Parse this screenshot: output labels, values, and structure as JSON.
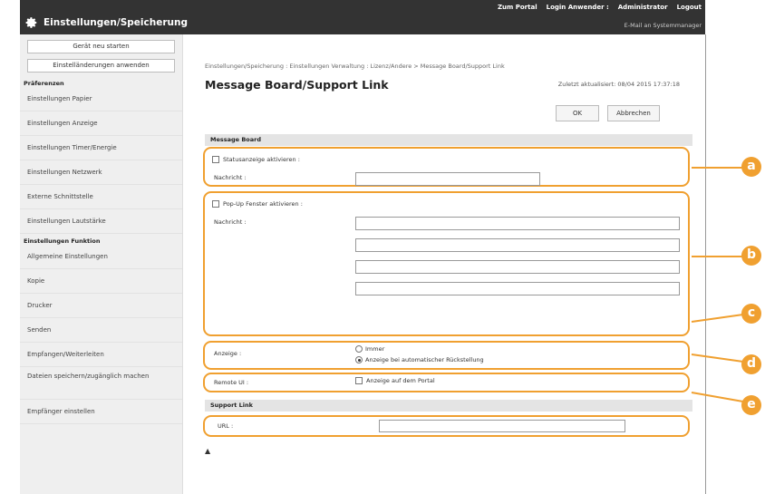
{
  "topbar": {
    "portal": "Zum Portal",
    "login_label": "Login Anwender :",
    "user": "Administrator",
    "logout": "Logout"
  },
  "header": {
    "title": "Einstellungen/Speicherung",
    "mail": "E-Mail an Systemmanager"
  },
  "sidebar": {
    "restart": "Gerät neu starten",
    "apply": "Einstelländerungen anwenden",
    "section1": "Präferenzen",
    "items1": [
      "Einstellungen Papier",
      "Einstellungen Anzeige",
      "Einstellungen Timer/Energie",
      "Einstellungen Netzwerk",
      "Externe Schnittstelle",
      "Einstellungen Lautstärke"
    ],
    "section2": "Einstellungen Funktion",
    "items2": [
      "Allgemeine Einstellungen",
      "Kopie",
      "Drucker",
      "Senden",
      "Empfangen/Weiterleiten",
      "Dateien speichern/zugänglich machen",
      "Empfänger einstellen"
    ]
  },
  "main": {
    "breadcrumb": "Einstellungen/Speicherung : Einstellungen Verwaltung : Lizenz/Andere > Message Board/Support Link",
    "title": "Message Board/Support Link",
    "updated": "Zuletzt aktualisiert: 08/04 2015 17:37:18",
    "ok": "OK",
    "cancel": "Abbrechen",
    "message_board": "Message Board",
    "status_enable": "Statusanzeige aktivieren :",
    "message_label": "Nachricht :",
    "popup_enable": "Pop-Up Fenster aktivieren :",
    "popup_message_label": "Nachricht :",
    "display_label": "Anzeige :",
    "display_opt1": "Immer",
    "display_opt2": "Anzeige bei automatischer Rückstellung",
    "remote_label": "Remote UI :",
    "remote_opt": "Anzeige auf dem Portal",
    "support_link": "Support Link",
    "url_label": "URL :",
    "totop": "▲"
  },
  "callouts": [
    "a",
    "b",
    "c",
    "d",
    "e"
  ],
  "colors": {
    "accent": "#f0a030",
    "header": "#3a3a3a"
  }
}
